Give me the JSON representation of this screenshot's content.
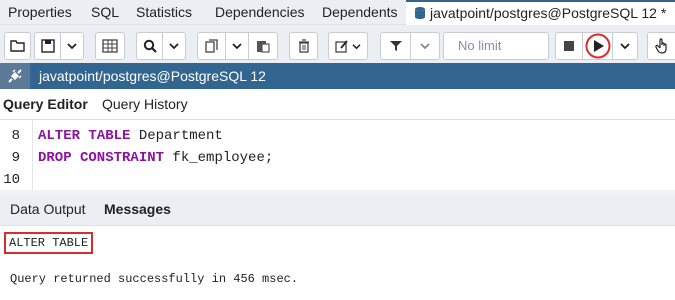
{
  "tabs": [
    "Properties",
    "SQL",
    "Statistics",
    "Dependencies",
    "Dependents"
  ],
  "active_tab": "javatpoint/postgres@PostgreSQL 12 *",
  "toolbar": {
    "limit_value": "No limit"
  },
  "connection": {
    "label": "javatpoint/postgres@PostgreSQL 12"
  },
  "subtabs": {
    "query_editor": "Query Editor",
    "query_history": "Query History"
  },
  "editor": {
    "lines": [
      {
        "num": "8",
        "keyword": "ALTER TABLE",
        "rest": " Department"
      },
      {
        "num": "9",
        "keyword": "DROP CONSTRAINT",
        "rest": " fk_employee;"
      },
      {
        "num": "10",
        "keyword": "",
        "rest": ""
      }
    ]
  },
  "output": {
    "data_output": "Data Output",
    "messages": "Messages"
  },
  "messages": {
    "line1": "ALTER TABLE",
    "line2": "Query returned successfully in 456 msec."
  },
  "colors": {
    "accent": "#326690",
    "keyword": "#8c12a2",
    "highlight": "#d32f2f"
  }
}
